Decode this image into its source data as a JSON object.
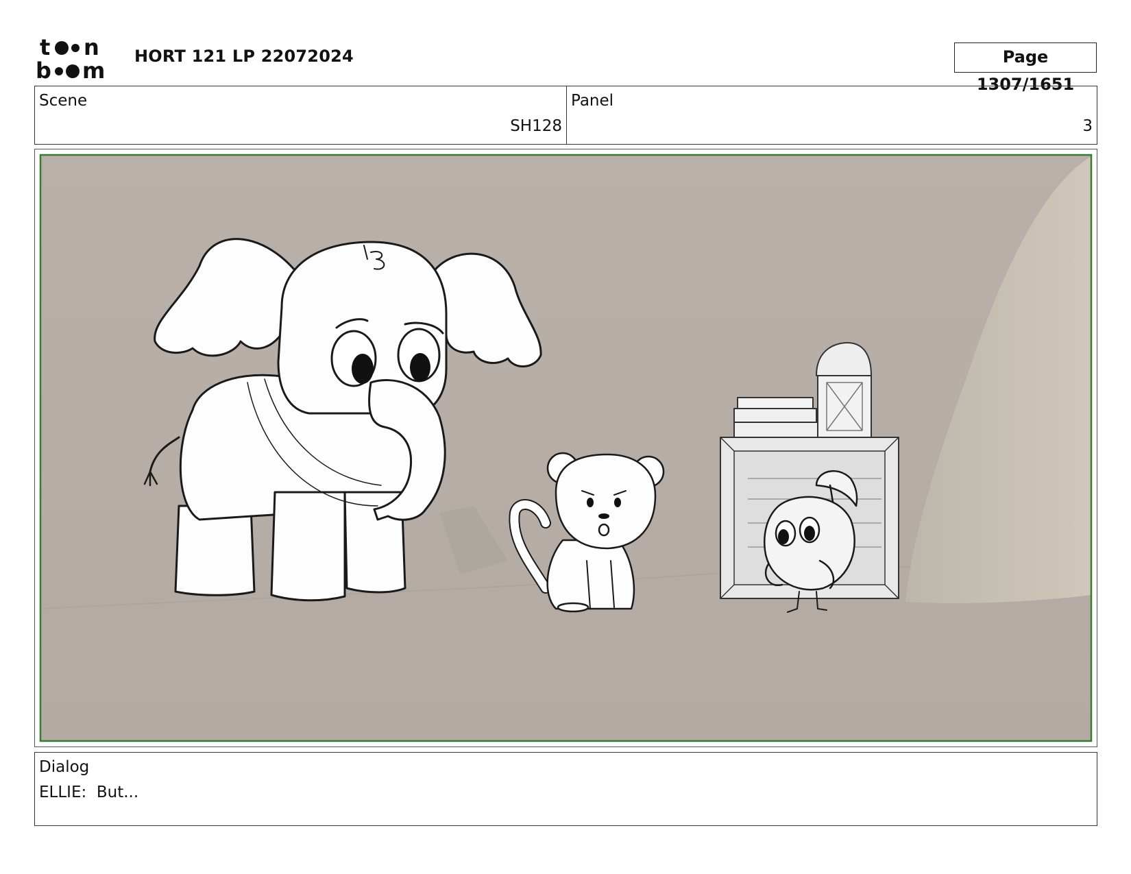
{
  "header": {
    "logo_text": "toonboom",
    "title": "HORT 121 LP 22072024",
    "page": "Page 1307/1651"
  },
  "scene": {
    "label": "Scene",
    "value": "SH128"
  },
  "panel": {
    "label": "Panel",
    "value": "3"
  },
  "dialog": {
    "label": "Dialog",
    "text": "ELLIE:  But..."
  },
  "colors": {
    "panel_background": "#b8b0a8",
    "frame_border": "#3b7a34",
    "sketch_line": "#1a1a1a"
  }
}
